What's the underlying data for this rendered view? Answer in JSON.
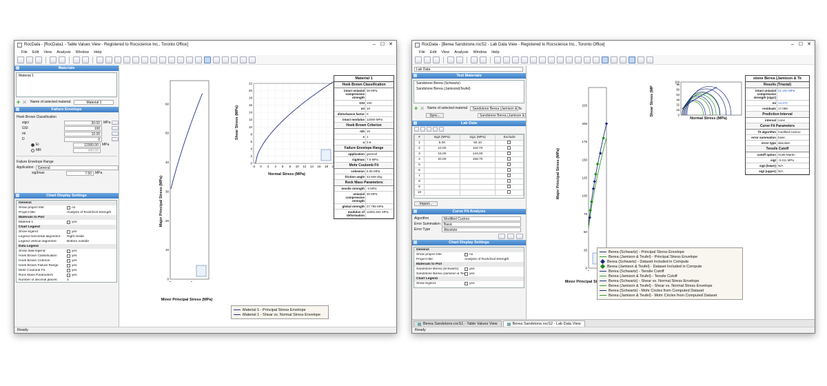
{
  "win1": {
    "title": "RocData - [RocData1 - Table Values View - Registered to Rocscience Inc., Toronto Office]",
    "menu": [
      "File",
      "Edit",
      "View",
      "Analysis",
      "Window",
      "Help"
    ],
    "materials_header": "Materials",
    "material_item": "Material 1",
    "name_label": "Name of selected material:",
    "name_value": "Material 1",
    "failure_header": "Failure Envelope",
    "hb_label": "Hoek Brown Classification",
    "params": [
      {
        "k": "sigci",
        "v": "30.00",
        "u": "MPa"
      },
      {
        "k": "GSI",
        "v": "100",
        "u": ""
      },
      {
        "k": "mi",
        "v": "10.00",
        "u": ""
      },
      {
        "k": "D",
        "v": "0",
        "u": ""
      }
    ],
    "ei_label": "Ei",
    "ei_value": "12000.00",
    "ei_unit": "MPa",
    "mr_label": "MR",
    "mr_value": "400.00",
    "range_label": "Failure Envelope Range",
    "app_label": "Application:",
    "app_value": "General",
    "sig3_label": "sig3max",
    "sig3_value": "7.50",
    "sig3_unit": "MPa",
    "chart_header": "Chart Display Settings",
    "settings": [
      {
        "t": "General:",
        "sec": true
      },
      {
        "t": "Show project title:",
        "v": "no",
        "cb": true
      },
      {
        "t": "Project title:",
        "v": "Analysis of Rock/Soil Strength"
      },
      {
        "t": "Materials to Plot",
        "sec": true
      },
      {
        "t": "Material 1",
        "v": "yes",
        "cb": true
      },
      {
        "t": "Chart Legend",
        "sec": true
      },
      {
        "t": "Show legend:",
        "v": "yes",
        "cb": true
      },
      {
        "t": "Legend horizontal alignment",
        "v": "Right inside"
      },
      {
        "t": "Legend vertical alignment",
        "v": "Bottom outside"
      },
      {
        "t": "Data Legend",
        "sec": true
      },
      {
        "t": "Show data legend:",
        "v": "yes",
        "cb": true
      },
      {
        "t": "Hoek Brown Classification",
        "v": "yes",
        "cb": true
      },
      {
        "t": "Hoek Brown Criterion",
        "v": "yes",
        "cb": true
      },
      {
        "t": "Hoek Brown Failure Range",
        "v": "yes",
        "cb": true
      },
      {
        "t": "Mohr Coulomb Fit",
        "v": "yes",
        "cb": true
      },
      {
        "t": "Rock Mass Parameters",
        "v": "yes",
        "cb": true
      },
      {
        "t": "Number of decimal places:",
        "v": "3"
      }
    ],
    "status": "Ready",
    "plot1": {
      "ylabel": "Major Principal Stress (MPa)",
      "xlabel": "Minor Principal Stress (MPa)",
      "yticks": [
        "0",
        "10",
        "20",
        "30",
        "40",
        "50",
        "60"
      ],
      "xticks": [
        "0",
        "5"
      ]
    },
    "plot2": {
      "ylabel": "Shear Stress (MPa)",
      "xlabel": "Normal Stress (MPa)",
      "yticks": [
        "0",
        "2",
        "4",
        "6",
        "8",
        "10",
        "12",
        "14",
        "16",
        "18",
        "20",
        "22"
      ],
      "xticks": [
        "-2",
        "0",
        "2",
        "4",
        "6",
        "8",
        "10",
        "12",
        "14",
        "16",
        "18",
        "20"
      ]
    },
    "table": {
      "title": "Material 1",
      "sections": [
        {
          "h": "Hoek Brown Classification",
          "rows": [
            [
              "intact uniaxial compressive strength",
              "30 MPa"
            ],
            [
              "GSI",
              "100"
            ],
            [
              "mi",
              "10"
            ],
            [
              "disturbance factor",
              "0"
            ],
            [
              "intact modulus",
              "12000 MPa"
            ]
          ]
        },
        {
          "h": "Hoek Brown Criterion",
          "rows": [
            [
              "mb",
              "10"
            ],
            [
              "s",
              "1"
            ],
            [
              "a",
              "0.5"
            ]
          ]
        },
        {
          "h": "Failure Envelope Range",
          "rows": [
            [
              "application",
              "general"
            ],
            [
              "sig3max",
              "7.5 MPa"
            ]
          ]
        },
        {
          "h": "Mohr Coulomb Fit",
          "rows": [
            [
              "cohesion",
              "6.05 MPa"
            ],
            [
              "friction angle",
              "42.948 deg"
            ]
          ]
        },
        {
          "h": "Rock Mass Parameters",
          "rows": [
            [
              "tensile strength",
              "-3 MPa"
            ],
            [
              "uniaxial compressive strength",
              "30 MPa"
            ],
            [
              "global strength",
              "27.795 MPa"
            ],
            [
              "modulus of deformation",
              "11901.941 MPa"
            ]
          ]
        }
      ]
    },
    "legend": [
      "Material 1 - Principal Stress Envelope",
      "Material 1 - Shear vs. Normal Stress Envelope"
    ]
  },
  "win2": {
    "title": "RocData - [Berea Sandstone.rocS2 - Lab Data View - Registered to Rocscience Inc., Toronto Office]",
    "menu": [
      "File",
      "Edit",
      "View",
      "Analysis",
      "Window",
      "Help"
    ],
    "lab_dropdown": "Lab Data",
    "test_header": "Test Materials",
    "tests": [
      "Sandstone Berea (Schwartz)",
      "Sandstone Berea (Jamison&Teufel)"
    ],
    "name_label": "Name of selected material:",
    "name_value": "Sandstone Berea (Jamison & Te",
    "sync_label": "Sync...",
    "sync_value": "Sandstone Berea (Jamison & Te",
    "lab_header": "Lab Data",
    "lab_cols": [
      "#",
      "sig3 (MPa)",
      "sig1 (MPa)",
      "Exclude"
    ],
    "lab_rows": [
      [
        "1",
        "5.00",
        "92.10"
      ],
      [
        "2",
        "10.00",
        "119.70"
      ],
      [
        "3",
        "15.00",
        "144.00"
      ],
      [
        "4",
        "20.00",
        "158.70"
      ],
      [
        "5",
        "",
        ""
      ],
      [
        "6",
        "",
        ""
      ],
      [
        "7",
        "",
        ""
      ],
      [
        "8",
        "",
        ""
      ],
      [
        "9",
        "",
        ""
      ],
      [
        "10",
        "",
        ""
      ]
    ],
    "import_label": "Import...",
    "curve_header": "Curve Fit Analysis",
    "curve_rows": [
      {
        "k": "Algorithm",
        "v": "Modified Cuckoo"
      },
      {
        "k": "Error Summation",
        "v": "Basic"
      },
      {
        "k": "Error Type",
        "v": "Absolute"
      }
    ],
    "chart_header": "Chart Display Settings",
    "settings": [
      {
        "t": "General:",
        "sec": true
      },
      {
        "t": "Show project title:",
        "v": "no",
        "cb": true
      },
      {
        "t": "Project title:",
        "v": "Analysis of Rock/Soil Strength"
      },
      {
        "t": "Materials to Plot",
        "sec": true
      },
      {
        "t": "Sandstone Berea (Schwartz)",
        "v": "yes",
        "cb": true
      },
      {
        "t": "Sandstone Berea (Jamison & Teufel)",
        "v": "yes",
        "cb": true
      },
      {
        "t": "Chart Legend",
        "sec": true
      },
      {
        "t": "Show legend:",
        "v": "yes",
        "cb": true
      }
    ],
    "status": "Ready",
    "plot1": {
      "ylabel": "Major Principal Stress (MPa)",
      "xlabel": "Minor Principal Stress (MPa)",
      "yticks": [
        "0",
        "25",
        "50",
        "75",
        "100",
        "125",
        "150",
        "175",
        "200",
        "225"
      ],
      "xticks": [
        "0",
        "25"
      ]
    },
    "plot2": {
      "ylabel": "Shear Stress (MP",
      "xlabel": "Normal Stress (MPa)",
      "yticks": [
        "0",
        "8",
        "16",
        "24",
        "32",
        "40",
        "48",
        "56",
        "64",
        "72",
        "80",
        "88",
        "96",
        "104"
      ],
      "xticks": "0 8 16 24 32 40 48 56 64 72 80 88 96 104 112 120 128 136 144 152 160 168 176 184 192 200 208 216 224 232 240 248 256 264 272 280 288 296 304 312 320 328 336 344 352 360 368 376 384 392 400 408 416 424 432 440 448 456 464 472 480 488 496 504 512 520 528 536 544 552 560 568 576 584 592 600 608 616 624 632 640 648 656 664 672 680 688 696 704 712 720 728 736 744 752 760 768 776 784 792 800 808 816 824 832 840 848 856 864 872 880 888 896 904 912 920 928 936 944 952 960 968 976 984 992 1000 1008 1016 1024 1032 1040 1048 1056 1064 1072 1080 1088 1096 1104 1112 1120 1128 1136 1144 1152 1160 1168 1176 1184 1192 1200 1208 1216 1224 1232 1240 1248 1256 1264 1272 1280 1288 1296 1304 1312 1320 1328 1336 1344 1352 1360 1368 1376 1384 1392 1400 1408 1416 1424 1432 1440 1448 1456 1464 1472 1480 1488 1496 1504 1512 1520 1528 1536 1544 1552 1560 1568 1576 1584 1592 1600 1608 1616 1624 1632 1640 1648 1656 1664 1672 1680 1688 1696 1704 1712 1720 1728 1736 1744 1752 1760 1768 1776 1784 1792 1800 1808 1816 1824 1832 1840 1848 1856 1864 1872 1880 1888 1896 1904 1912 1920 1928 1936 1944 1952 1960 1968 1976 1984 1992 2000 2008 2016 2024 2032 2040 2048 2056 2064 2072 2080 2088 2096 2104 2112 2120 2128 2136 2144 2152 2160 2168 2176 2184 2192 2200 2208 2216 2224 2232 2240 2248 2256 2264 2272 2280 2288 2296 2304 2312 2320 2328 2336 2344 2352 2360 2368 2376 2384 2392 2400 2408 2416 2424 2432 2440 2448 2456 2464 2472 2480 2488 2496 2504 2512 2520 2528 2536 2544 2552 2560 2568 2576 2584 2592 2600 2608 2616 2624 2632 2640 2648 2656 2664 2672 2680 2688 2696 2704 2712 2720 2728 2736 2744 2752 2760 2768 2776 2784 2792 2800 2808 2816 2824 2832 2840 2848 2856 2864 2872 2880 2888 2896 2904 2912 2920 2928 2936 2944 2952 2960 2968 2976 2984 2992 3000 3008 3016 3024 3032 3040 3048 3056 3064 3072 3080 3088 3096 3104 3112 3120 3128 3136 3144 3152 3160 3168 3176 3184 3192 3200 3208 3216 3224 3232 3240 3248 3256 3264 3272 3280 3288 3296 3304 3312 3320 3328 3336 3344 3352 3360 3368 3376 3384 3392 3400 3408 3416 3424 3432 3440 3448 3456 3464 3472 3480 3488 3496 3504 3512 3520 3528 3536 3544 3552 3560 3568 3576 3584 3592 3600 3608 3616 3624 3632 3640 3648 3656 3664 3672 3680 3688 3696 3704 3712 3720 3728 3736 3744 3752 3760 3768 3776 3784 3792 3800 3808 3816 3824 3832 3840 3848 3856 3864 3872 3880 3888 3896 3904 3912 3920 3928 3936 3944 3952 3960 3968 3976 3984 3992 4000 4008 4016 4024 4032 4040 4048 4056 4064 4072 4080 4088 4096 4104 4112 4120 4128 4136 4144 4152 4160 4168 4176 4184 4192 4200 4208 4216 4224 4232 4240 4248 4256 4264 4272 4280 4288 4296 4304 4312 4320 4328 4336 4344 4352 4360 4368 4376 4384 4392 4400 4408 4416 4424 4432 4440 4448 4456 4464 4472 4480 4488 4496 4504 4512 4520 4528 4536 4544 4552 4560 4568 4576 4584 4592 4600 4608 4616 4624 4632 4640 4648 4656 4664 4672 4680 4688 4696 4704 4712 4720 4728 4736 4744 4752 4760 4768 4776 4784 4792 4800 4808 4816 4824 4832 4840 4848 4856 4864 4872 4880 4888 4896 4904 4912 4920 4928 4936 4944 4952 4960 4968 4976 4984 4992 5000"
    },
    "table": {
      "title": "stone Berea (Jamison & Te",
      "sections": [
        {
          "h": "Results (Triaxial)",
          "rows": [
            [
              "intact uniaxial compressive strength (sigci)",
              "61.102 MPa"
            ],
            [
              "mi",
              "13.272"
            ],
            [
              "residuals",
              "17.099"
            ]
          ]
        },
        {
          "h": "Prediction Interval",
          "rows": [
            [
              "interval",
              "none"
            ]
          ]
        },
        {
          "h": "Curve Fit Parameters",
          "rows": [
            [
              "fit algorithm",
              "modified cuckoo"
            ],
            [
              "error summation",
              "basic"
            ],
            [
              "error type",
              "absolute"
            ]
          ]
        },
        {
          "h": "Tensile Cutoff",
          "rows": [
            [
              "cutoff option",
              "Hoek-Martin"
            ],
            [
              "sigt",
              "-3.411 MPa"
            ],
            [
              "sigt (lower)",
              "N/A"
            ],
            [
              "sigt (upper)",
              "N/A"
            ]
          ]
        }
      ]
    },
    "legend": [
      {
        "t": "Berea (Schwartz) - Principal Stress Envelope",
        "c": "#1f2a80",
        "k": "line"
      },
      {
        "t": "Berea (Jamison & Teufel) - Principal Stress Envelope",
        "c": "#2f9a2f",
        "k": "line"
      },
      {
        "t": "Berea (Schwartz) - Dataset Included in Compute",
        "c": "#1f2a80",
        "k": "dia"
      },
      {
        "t": "Berea (Jamison & Teufel) - Dataset Included in Compute",
        "c": "#138a13",
        "k": "dia"
      },
      {
        "t": "Berea (Schwartz) - Tensile Cutoff",
        "c": "#1f2a80",
        "k": "line"
      },
      {
        "t": "Berea (Jamison & Teufel) - Tensile Cutoff",
        "c": "#2f9a2f",
        "k": "line"
      },
      {
        "t": "Berea (Schwartz) - Shear vs. Normal Stress Envelope",
        "c": "#1f2a80",
        "k": "line"
      },
      {
        "t": "Berea (Jamison & Teufel) - Shear vs. Normal Stress Envelope",
        "c": "#2f9a2f",
        "k": "line"
      },
      {
        "t": "Berea (Schwartz) - Mohr Circles from Computed Dataset",
        "c": "#1f2a80",
        "k": "line"
      },
      {
        "t": "Berea (Jamison & Teufel) - Mohr Circles from Computed Dataset",
        "c": "#2f9a2f",
        "k": "line"
      }
    ],
    "tabs": [
      "Berea Sandstone.rocS1 - Table Values View",
      "Berea Sandstone.rocS2 - Lab Data View"
    ]
  }
}
